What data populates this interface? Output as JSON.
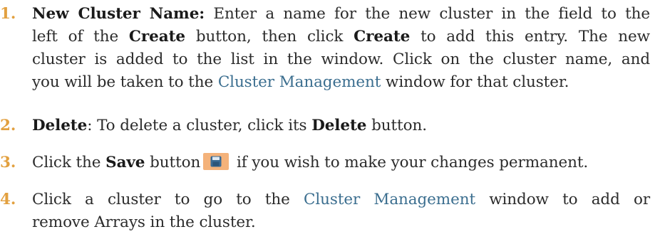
{
  "items": [
    {
      "number": "1.",
      "label": "New Cluster Name:",
      "l1_after": " Enter a name for the new cluster in the field to the",
      "l2_a": "left of the ",
      "l2_create1": "Create",
      "l2_b": " button, then click ",
      "l2_create2": "Create",
      "l2_c": " to add this entry. The new",
      "l3": "cluster is added to the list in the window. Click on the cluster name, and",
      "l4_a": "you will be taken to the ",
      "l4_link": "Cluster Management",
      "l4_b": " window for that cluster."
    },
    {
      "number": "2.",
      "label": "Delete",
      "text_a": ": To delete a cluster, click its ",
      "bold": "Delete",
      "text_b": " button."
    },
    {
      "number": "3.",
      "text_a": "Click the ",
      "bold": "Save",
      "text_b": " button",
      "icon": "save-icon",
      "text_c": " if you wish to make your changes permanent."
    },
    {
      "number": "4.",
      "l1_a": "Click a cluster to go to the ",
      "l1_link": "Cluster Management",
      "l1_b": " window to add or",
      "l2": "remove Arrays in the cluster."
    }
  ],
  "colors": {
    "number": "#e2a03f",
    "link": "#3b6e8f",
    "icon_bg": "#f4b27a",
    "icon_fg": "#3a6a93"
  }
}
